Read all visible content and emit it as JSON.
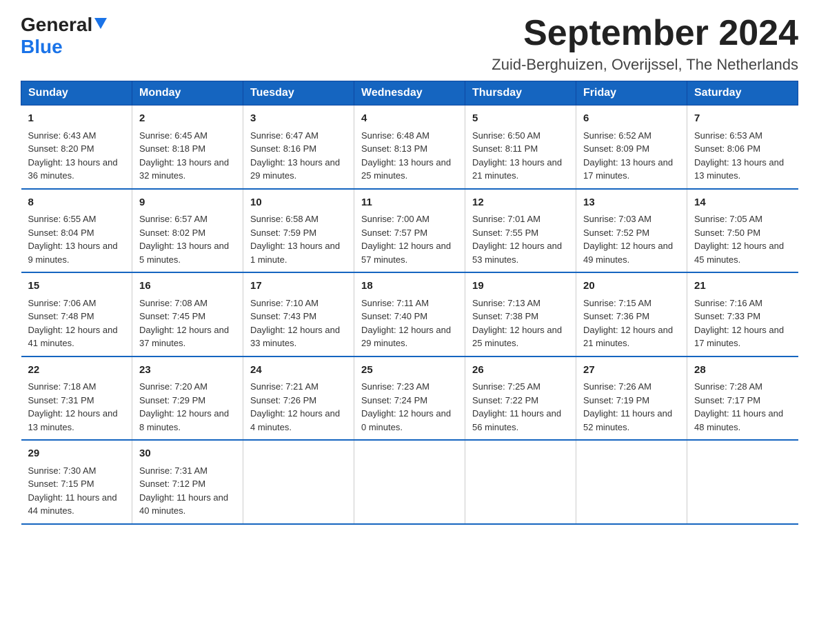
{
  "header": {
    "logo_general": "General",
    "logo_blue": "Blue",
    "title": "September 2024",
    "location": "Zuid-Berghuizen, Overijssel, The Netherlands"
  },
  "weekdays": [
    "Sunday",
    "Monday",
    "Tuesday",
    "Wednesday",
    "Thursday",
    "Friday",
    "Saturday"
  ],
  "weeks": [
    [
      {
        "day": "1",
        "sunrise": "Sunrise: 6:43 AM",
        "sunset": "Sunset: 8:20 PM",
        "daylight": "Daylight: 13 hours and 36 minutes."
      },
      {
        "day": "2",
        "sunrise": "Sunrise: 6:45 AM",
        "sunset": "Sunset: 8:18 PM",
        "daylight": "Daylight: 13 hours and 32 minutes."
      },
      {
        "day": "3",
        "sunrise": "Sunrise: 6:47 AM",
        "sunset": "Sunset: 8:16 PM",
        "daylight": "Daylight: 13 hours and 29 minutes."
      },
      {
        "day": "4",
        "sunrise": "Sunrise: 6:48 AM",
        "sunset": "Sunset: 8:13 PM",
        "daylight": "Daylight: 13 hours and 25 minutes."
      },
      {
        "day": "5",
        "sunrise": "Sunrise: 6:50 AM",
        "sunset": "Sunset: 8:11 PM",
        "daylight": "Daylight: 13 hours and 21 minutes."
      },
      {
        "day": "6",
        "sunrise": "Sunrise: 6:52 AM",
        "sunset": "Sunset: 8:09 PM",
        "daylight": "Daylight: 13 hours and 17 minutes."
      },
      {
        "day": "7",
        "sunrise": "Sunrise: 6:53 AM",
        "sunset": "Sunset: 8:06 PM",
        "daylight": "Daylight: 13 hours and 13 minutes."
      }
    ],
    [
      {
        "day": "8",
        "sunrise": "Sunrise: 6:55 AM",
        "sunset": "Sunset: 8:04 PM",
        "daylight": "Daylight: 13 hours and 9 minutes."
      },
      {
        "day": "9",
        "sunrise": "Sunrise: 6:57 AM",
        "sunset": "Sunset: 8:02 PM",
        "daylight": "Daylight: 13 hours and 5 minutes."
      },
      {
        "day": "10",
        "sunrise": "Sunrise: 6:58 AM",
        "sunset": "Sunset: 7:59 PM",
        "daylight": "Daylight: 13 hours and 1 minute."
      },
      {
        "day": "11",
        "sunrise": "Sunrise: 7:00 AM",
        "sunset": "Sunset: 7:57 PM",
        "daylight": "Daylight: 12 hours and 57 minutes."
      },
      {
        "day": "12",
        "sunrise": "Sunrise: 7:01 AM",
        "sunset": "Sunset: 7:55 PM",
        "daylight": "Daylight: 12 hours and 53 minutes."
      },
      {
        "day": "13",
        "sunrise": "Sunrise: 7:03 AM",
        "sunset": "Sunset: 7:52 PM",
        "daylight": "Daylight: 12 hours and 49 minutes."
      },
      {
        "day": "14",
        "sunrise": "Sunrise: 7:05 AM",
        "sunset": "Sunset: 7:50 PM",
        "daylight": "Daylight: 12 hours and 45 minutes."
      }
    ],
    [
      {
        "day": "15",
        "sunrise": "Sunrise: 7:06 AM",
        "sunset": "Sunset: 7:48 PM",
        "daylight": "Daylight: 12 hours and 41 minutes."
      },
      {
        "day": "16",
        "sunrise": "Sunrise: 7:08 AM",
        "sunset": "Sunset: 7:45 PM",
        "daylight": "Daylight: 12 hours and 37 minutes."
      },
      {
        "day": "17",
        "sunrise": "Sunrise: 7:10 AM",
        "sunset": "Sunset: 7:43 PM",
        "daylight": "Daylight: 12 hours and 33 minutes."
      },
      {
        "day": "18",
        "sunrise": "Sunrise: 7:11 AM",
        "sunset": "Sunset: 7:40 PM",
        "daylight": "Daylight: 12 hours and 29 minutes."
      },
      {
        "day": "19",
        "sunrise": "Sunrise: 7:13 AM",
        "sunset": "Sunset: 7:38 PM",
        "daylight": "Daylight: 12 hours and 25 minutes."
      },
      {
        "day": "20",
        "sunrise": "Sunrise: 7:15 AM",
        "sunset": "Sunset: 7:36 PM",
        "daylight": "Daylight: 12 hours and 21 minutes."
      },
      {
        "day": "21",
        "sunrise": "Sunrise: 7:16 AM",
        "sunset": "Sunset: 7:33 PM",
        "daylight": "Daylight: 12 hours and 17 minutes."
      }
    ],
    [
      {
        "day": "22",
        "sunrise": "Sunrise: 7:18 AM",
        "sunset": "Sunset: 7:31 PM",
        "daylight": "Daylight: 12 hours and 13 minutes."
      },
      {
        "day": "23",
        "sunrise": "Sunrise: 7:20 AM",
        "sunset": "Sunset: 7:29 PM",
        "daylight": "Daylight: 12 hours and 8 minutes."
      },
      {
        "day": "24",
        "sunrise": "Sunrise: 7:21 AM",
        "sunset": "Sunset: 7:26 PM",
        "daylight": "Daylight: 12 hours and 4 minutes."
      },
      {
        "day": "25",
        "sunrise": "Sunrise: 7:23 AM",
        "sunset": "Sunset: 7:24 PM",
        "daylight": "Daylight: 12 hours and 0 minutes."
      },
      {
        "day": "26",
        "sunrise": "Sunrise: 7:25 AM",
        "sunset": "Sunset: 7:22 PM",
        "daylight": "Daylight: 11 hours and 56 minutes."
      },
      {
        "day": "27",
        "sunrise": "Sunrise: 7:26 AM",
        "sunset": "Sunset: 7:19 PM",
        "daylight": "Daylight: 11 hours and 52 minutes."
      },
      {
        "day": "28",
        "sunrise": "Sunrise: 7:28 AM",
        "sunset": "Sunset: 7:17 PM",
        "daylight": "Daylight: 11 hours and 48 minutes."
      }
    ],
    [
      {
        "day": "29",
        "sunrise": "Sunrise: 7:30 AM",
        "sunset": "Sunset: 7:15 PM",
        "daylight": "Daylight: 11 hours and 44 minutes."
      },
      {
        "day": "30",
        "sunrise": "Sunrise: 7:31 AM",
        "sunset": "Sunset: 7:12 PM",
        "daylight": "Daylight: 11 hours and 40 minutes."
      },
      null,
      null,
      null,
      null,
      null
    ]
  ]
}
